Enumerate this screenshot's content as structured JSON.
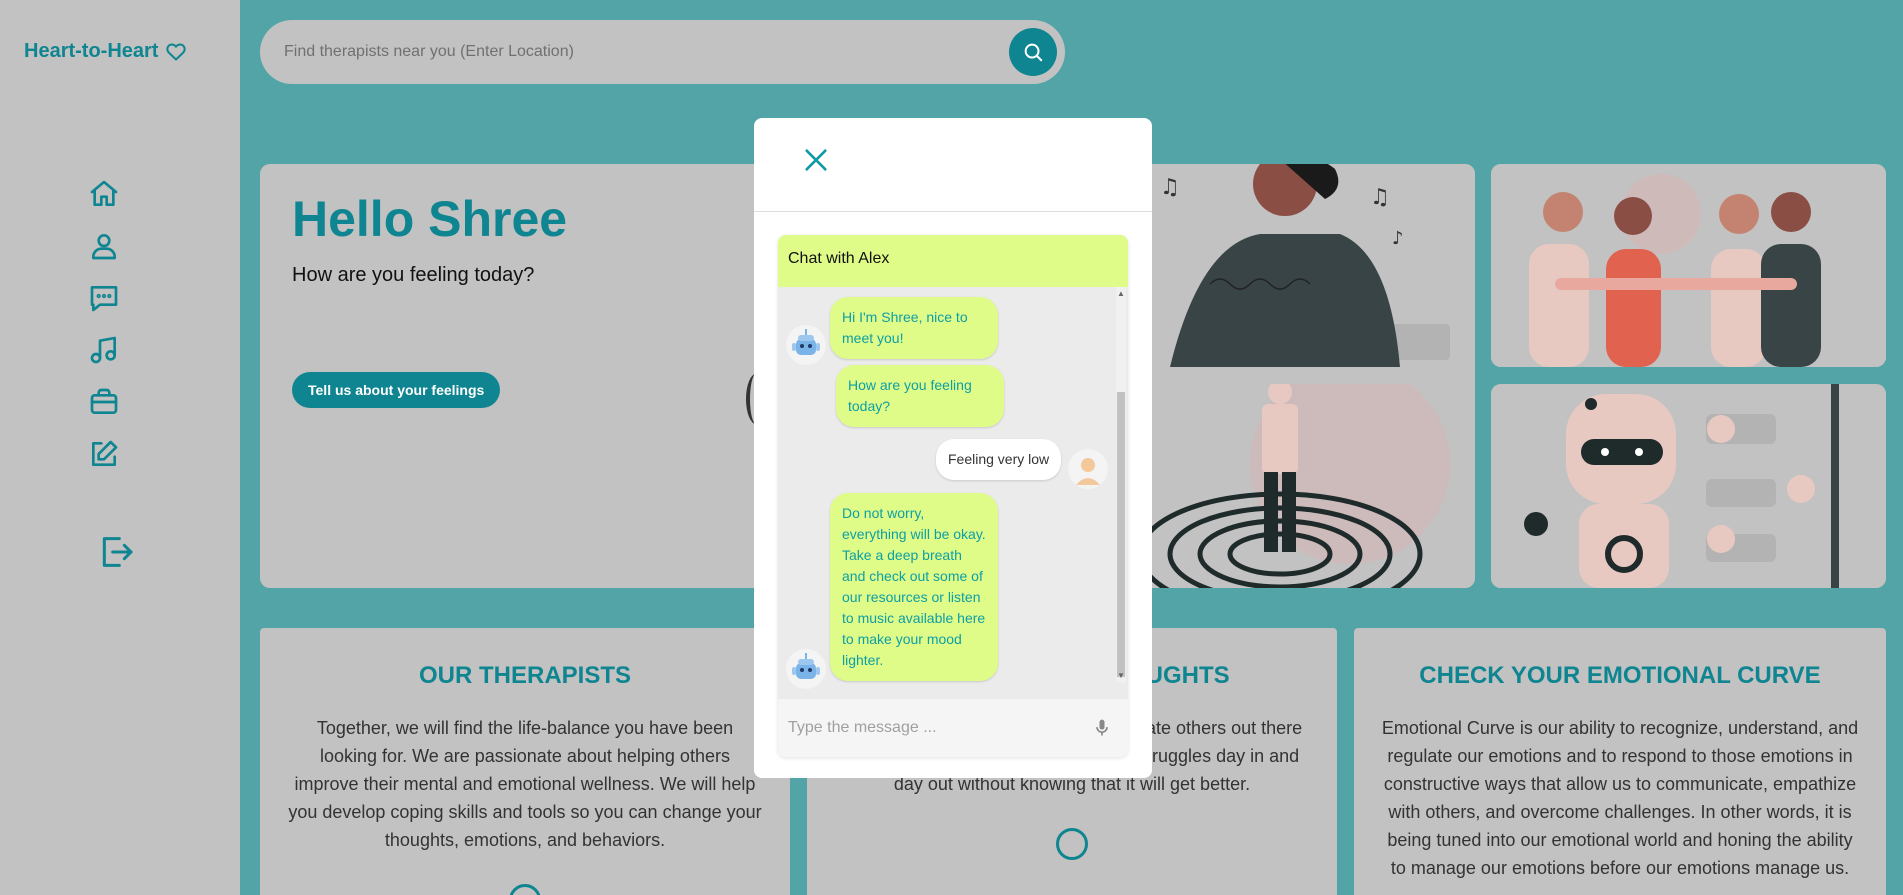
{
  "brand": {
    "name": "Heart-to-Heart"
  },
  "search": {
    "placeholder": "Find therapists near you (Enter Location)"
  },
  "nav": [
    {
      "icon": "home-icon"
    },
    {
      "icon": "user-icon"
    },
    {
      "icon": "chat-icon"
    },
    {
      "icon": "music-icon"
    },
    {
      "icon": "briefcase-icon"
    },
    {
      "icon": "edit-icon"
    },
    {
      "icon": "logout-icon"
    }
  ],
  "hero": {
    "title": "Hello Shree",
    "subtitle": "How are you feeling today?",
    "button": "Tell us about your feelings"
  },
  "cards": [
    {
      "title": "OUR THERAPISTS",
      "body": "Together, we will find the life-balance you have been looking for. We are passionate about helping others improve their mental and emotional wellness. We will help you develop coping skills and tools so you can change your thoughts, emotions, and behaviors."
    },
    {
      "title": "OUGHTS",
      "body": "are of ups and down inspire and motivate others out there that may be going through the same struggles day in and day out without knowing that it will get better."
    },
    {
      "title": "CHECK YOUR EMOTIONAL CURVE",
      "body": "Emotional Curve is our ability to recognize, understand, and regulate our emotions and to respond to those emotions in constructive ways that allow us to communicate, empathize with others, and overcome challenges. In other words, it is being tuned into our emotional world and honing the ability to manage our emotions before our emotions manage us."
    }
  ],
  "chat": {
    "title": "Chat with Alex",
    "input_placeholder": "Type the message ...",
    "messages": [
      {
        "from": "bot",
        "text": "Hi I'm Shree, nice to meet you!"
      },
      {
        "from": "bot",
        "text": "How are you feeling today?"
      },
      {
        "from": "user",
        "text": "Feeling very low"
      },
      {
        "from": "bot",
        "text": "Do not worry, everything will be okay. Take a deep breath and check out some of our resources or listen to music available here to make your mood lighter."
      }
    ]
  },
  "colors": {
    "accent": "#0e8590",
    "background": "#52a4a6",
    "bot_bubble": "#e0fc88",
    "panel": "#c2c2c2"
  }
}
